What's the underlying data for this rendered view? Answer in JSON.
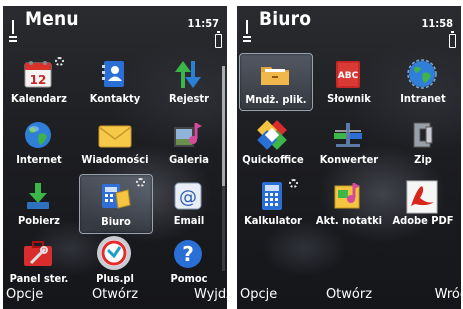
{
  "screens": [
    {
      "title": "Menu",
      "clock": "11:57",
      "items": [
        {
          "label": "Kalendarz",
          "icon": "calendar-icon",
          "badge": true
        },
        {
          "label": "Kontakty",
          "icon": "contacts-icon",
          "badge": false
        },
        {
          "label": "Rejestr",
          "icon": "log-arrows-icon",
          "badge": false
        },
        {
          "label": "Internet",
          "icon": "globe-icon",
          "badge": false
        },
        {
          "label": "Wiadomości",
          "icon": "envelope-icon",
          "badge": false
        },
        {
          "label": "Galeria",
          "icon": "gallery-icon",
          "badge": false
        },
        {
          "label": "Pobierz",
          "icon": "download-icon",
          "badge": false
        },
        {
          "label": "Biuro",
          "icon": "office-icon",
          "badge": true,
          "selected": true
        },
        {
          "label": "Email",
          "icon": "email-icon",
          "badge": false
        },
        {
          "label": "Panel ster.",
          "icon": "toolbox-icon",
          "badge": false
        },
        {
          "label": "Plus.pl",
          "icon": "plus-logo-icon",
          "badge": false
        },
        {
          "label": "Pomoc",
          "icon": "help-icon",
          "badge": false
        }
      ],
      "softkeys": {
        "left": "Opcje",
        "middle": "Otwórz",
        "right": "Wyjdź"
      }
    },
    {
      "title": "Biuro",
      "clock": "11:58",
      "items": [
        {
          "label": "Mndż. plik.",
          "icon": "file-manager-icon",
          "badge": false,
          "selected": true
        },
        {
          "label": "Słownik",
          "icon": "dictionary-icon",
          "badge": false
        },
        {
          "label": "Intranet",
          "icon": "intranet-globe-icon",
          "badge": false
        },
        {
          "label": "Quickoffice",
          "icon": "quickoffice-icon",
          "badge": false
        },
        {
          "label": "Konwerter",
          "icon": "converter-icon",
          "badge": false
        },
        {
          "label": "Zip",
          "icon": "zip-clamp-icon",
          "badge": false
        },
        {
          "label": "Kalkulator",
          "icon": "calculator-icon",
          "badge": true
        },
        {
          "label": "Akt. notatki",
          "icon": "notes-icon",
          "badge": false
        },
        {
          "label": "Adobe PDF",
          "icon": "adobe-pdf-icon",
          "badge": false
        }
      ],
      "softkeys": {
        "left": "Opcje",
        "middle": "Otwórz",
        "right": "Wróć"
      }
    }
  ],
  "dictionary_badge_text": "ABC",
  "calendar_day": "12"
}
